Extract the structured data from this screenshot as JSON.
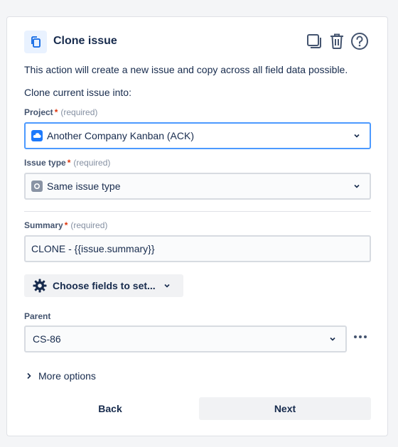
{
  "header": {
    "title": "Clone issue",
    "icons": [
      "clone-icon",
      "duplicate-icon",
      "delete-icon",
      "help-icon"
    ]
  },
  "description": "This action will create a new issue and copy across all field data possible.",
  "clone_into_label": "Clone current issue into:",
  "project": {
    "label": "Project",
    "required_mark": "*",
    "hint": "(required)",
    "value": "Another Company Kanban (ACK)"
  },
  "issue_type": {
    "label": "Issue type",
    "required_mark": "*",
    "hint": "(required)",
    "value": "Same issue type"
  },
  "summary": {
    "label": "Summary",
    "required_mark": "*",
    "hint": "(required)",
    "value": "CLONE - {{issue.summary}}"
  },
  "choose_fields": {
    "label": "Choose fields to set..."
  },
  "parent": {
    "label": "Parent",
    "value": "CS-86"
  },
  "more_options": {
    "label": "More options"
  },
  "footer": {
    "back": "Back",
    "next": "Next"
  },
  "colors": {
    "accent": "#0c66e4",
    "focus_border": "#4c9aff",
    "required": "#de350b"
  }
}
